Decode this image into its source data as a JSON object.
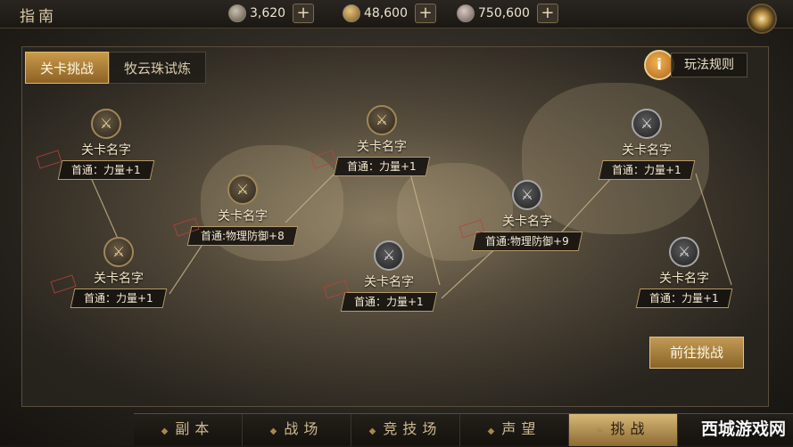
{
  "header": {
    "title": "指南",
    "resources": [
      {
        "icon": "stamina-icon",
        "value": "3,620"
      },
      {
        "icon": "gold-coin-icon",
        "value": "48,600"
      },
      {
        "icon": "silver-coin-icon",
        "value": "750,600"
      }
    ],
    "plus_label": "+"
  },
  "tabs": [
    {
      "label": "关卡挑战",
      "active": true
    },
    {
      "label": "牧云珠试炼",
      "active": false
    }
  ],
  "rules": {
    "icon_label": "i",
    "label": "玩法规则"
  },
  "stages": [
    {
      "name": "关卡名字",
      "reward": "首通：力量+1"
    },
    {
      "name": "关卡名字",
      "reward": "首通：力量+1"
    },
    {
      "name": "关卡名字",
      "reward": "首通:物理防御+8"
    },
    {
      "name": "关卡名字",
      "reward": "首通：力量+1"
    },
    {
      "name": "关卡名字",
      "reward": "首通：力量+1"
    },
    {
      "name": "关卡名字",
      "reward": "首通:物理防御+9"
    },
    {
      "name": "关卡名字",
      "reward": "首通：力量+1"
    },
    {
      "name": "关卡名字",
      "reward": "首通：力量+1"
    }
  ],
  "challenge_button": "前往挑战",
  "bottom_nav": [
    {
      "label": "副本",
      "active": false
    },
    {
      "label": "战场",
      "active": false
    },
    {
      "label": "竞技场",
      "active": false
    },
    {
      "label": "声望",
      "active": false
    },
    {
      "label": "挑战",
      "active": true
    }
  ],
  "watermark": "西城游戏网"
}
